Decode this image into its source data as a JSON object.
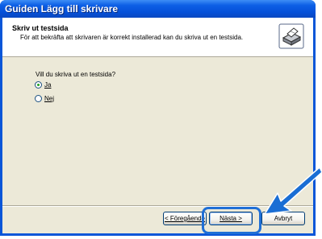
{
  "window": {
    "title": "Guiden Lägg till skrivare"
  },
  "header": {
    "title": "Skriv ut testsida",
    "subtitle": "För att bekräfta att skrivaren är korrekt installerad kan du skriva ut en testsida.",
    "icon": "printer-icon"
  },
  "body": {
    "question": "Vill du skriva ut en testsida?",
    "options": [
      {
        "label": "Ja",
        "selected": true
      },
      {
        "label": "Nej",
        "selected": false
      }
    ]
  },
  "buttons": {
    "back": "< Föregående",
    "next": "Nästa >",
    "cancel": "Avbryt"
  },
  "annotation": {
    "highlight_color": "#1f6fd6",
    "arrow_color": "#1a6ed4"
  },
  "colors": {
    "title_bar": "#0550d8",
    "dialog_background": "#ece9d8",
    "radio_selected": "#21a121"
  }
}
